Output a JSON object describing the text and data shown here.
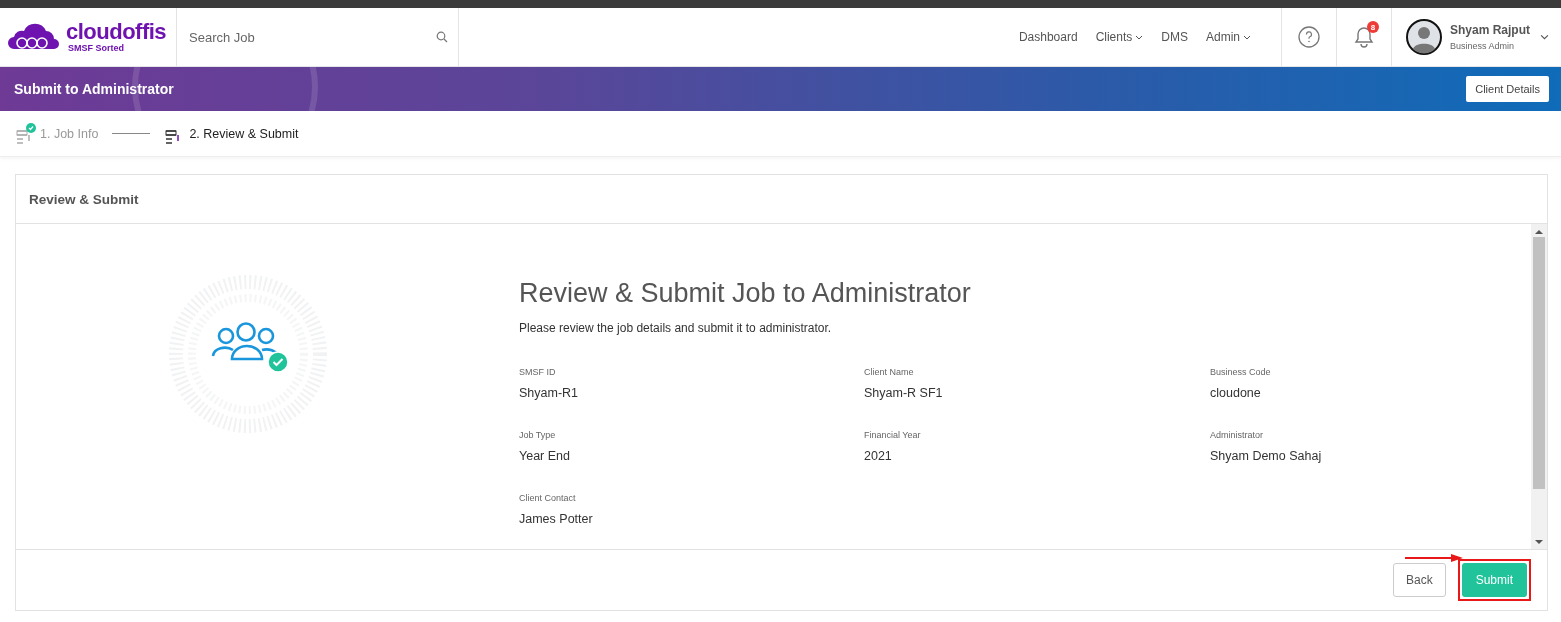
{
  "header": {
    "logo": {
      "name": "cloudoffis",
      "tagline": "SMSF Sorted"
    },
    "search": {
      "placeholder": "Search Job"
    },
    "nav": [
      {
        "label": "Dashboard",
        "dropdown": false
      },
      {
        "label": "Clients",
        "dropdown": true
      },
      {
        "label": "DMS",
        "dropdown": false
      },
      {
        "label": "Admin",
        "dropdown": true
      }
    ],
    "notifications": {
      "count": "8"
    },
    "user": {
      "name": "Shyam Rajput",
      "role": "Business Admin"
    }
  },
  "banner": {
    "title": "Submit to Administrator",
    "button": "Client Details"
  },
  "steps": [
    {
      "label": "1. Job Info",
      "selected": false,
      "completed": true
    },
    {
      "label": "2. Review & Submit",
      "selected": true,
      "completed": false
    }
  ],
  "card": {
    "title": "Review & Submit",
    "heading": "Review & Submit Job to Administrator",
    "intro": "Please review the job details and submit it to administrator.",
    "fields": [
      {
        "label": "SMSF ID",
        "value": "Shyam-R1"
      },
      {
        "label": "Client Name",
        "value": "Shyam-R SF1"
      },
      {
        "label": "Business Code",
        "value": "cloudone"
      },
      {
        "label": "Job Type",
        "value": "Year End"
      },
      {
        "label": "Financial Year",
        "value": "2021"
      },
      {
        "label": "Administrator",
        "value": "Shyam Demo Sahaj"
      },
      {
        "label": "Client Contact",
        "value": "James Potter"
      }
    ],
    "buttons": [
      {
        "label": "Back",
        "kind": "secondary"
      },
      {
        "label": "Submit",
        "kind": "primary"
      }
    ]
  }
}
